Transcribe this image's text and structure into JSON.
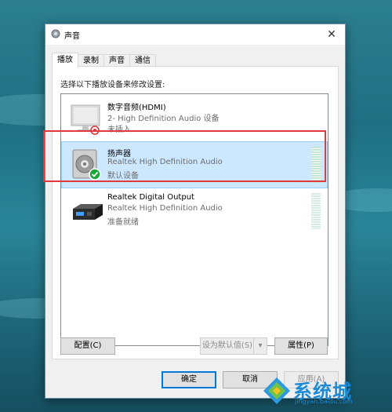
{
  "window": {
    "title": "声音",
    "close_glyph": "✕"
  },
  "tabs": [
    {
      "label": "播放",
      "active": true
    },
    {
      "label": "录制",
      "active": false
    },
    {
      "label": "声音",
      "active": false
    },
    {
      "label": "通信",
      "active": false
    }
  ],
  "instruction": "选择以下播放设备来修改设置:",
  "devices": [
    {
      "name": "数字音频(HDMI)",
      "description": "2- High Definition Audio 设备",
      "status": "未插入",
      "icon": "monitor-icon",
      "status_icon": "disconnected-icon",
      "selected": false
    },
    {
      "name": "扬声器",
      "description": "Realtek High Definition Audio",
      "status": "默认设备",
      "icon": "speaker-icon",
      "status_icon": "default-check-icon",
      "selected": true
    },
    {
      "name": "Realtek Digital Output",
      "description": "Realtek High Definition Audio",
      "status": "准备就绪",
      "icon": "digital-output-icon",
      "status_icon": "",
      "selected": false
    }
  ],
  "buttons": {
    "configure": "配置(C)",
    "set_default": "设为默认值(S)",
    "set_default_dropdown": "▾",
    "properties": "属性(P)",
    "ok": "确定",
    "cancel": "取消",
    "apply": "应用(A)"
  },
  "watermark": {
    "text": "系统城",
    "url": "jingyan.baidu.com"
  },
  "colors": {
    "selection_bg": "#cce8ff",
    "highlight_border": "#e23a3a",
    "accent": "#0078d7"
  }
}
